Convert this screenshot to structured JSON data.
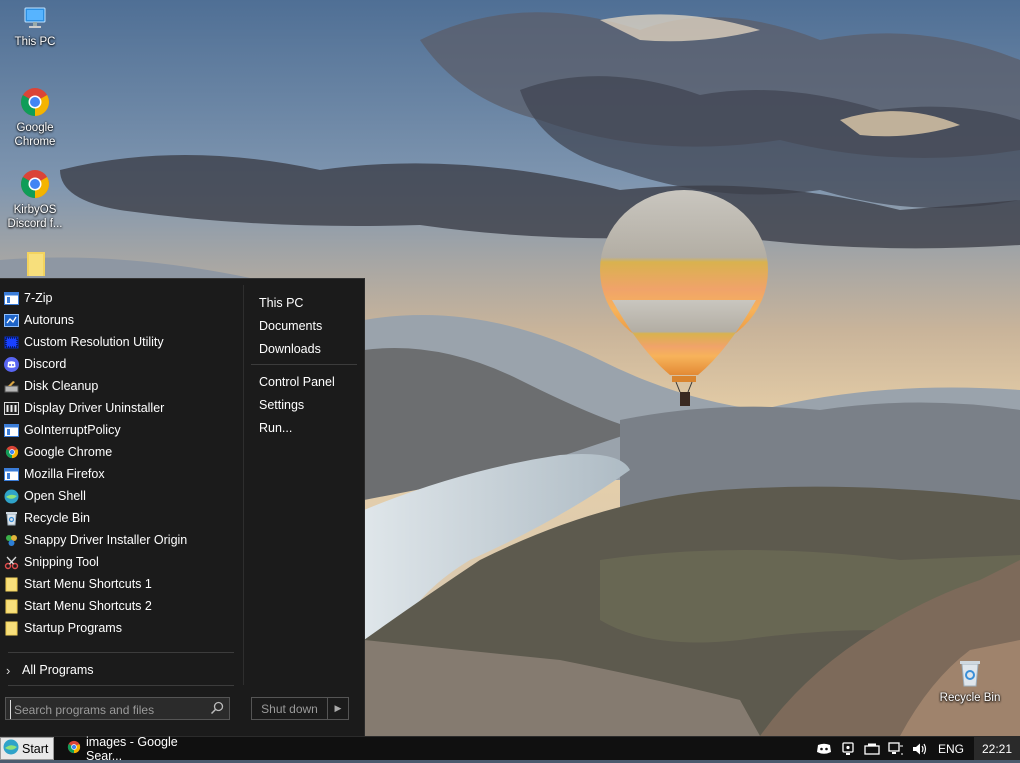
{
  "desktop": {
    "icons": [
      {
        "label": "This PC",
        "icon": "computer-icon"
      },
      {
        "label": "Google Chrome",
        "icon": "chrome-icon"
      },
      {
        "label": "KirbyOS Discord f...",
        "icon": "chrome-icon"
      },
      {
        "label": "",
        "icon": "folder-shortcut-icon"
      },
      {
        "label": "Recycle Bin",
        "icon": "recycle-bin-icon"
      }
    ]
  },
  "start_menu": {
    "programs": [
      {
        "label": "7-Zip",
        "icon": "window-icon"
      },
      {
        "label": "Autoruns",
        "icon": "autoruns-icon"
      },
      {
        "label": "Custom Resolution Utility",
        "icon": "monitor-icon"
      },
      {
        "label": "Discord",
        "icon": "discord-icon"
      },
      {
        "label": "Disk Cleanup",
        "icon": "disk-cleanup-icon"
      },
      {
        "label": "Display Driver Uninstaller",
        "icon": "ddu-icon"
      },
      {
        "label": "GoInterruptPolicy",
        "icon": "window-icon"
      },
      {
        "label": "Google Chrome",
        "icon": "chrome-icon"
      },
      {
        "label": "Mozilla Firefox",
        "icon": "window-icon"
      },
      {
        "label": "Open Shell",
        "icon": "shell-icon"
      },
      {
        "label": "Recycle Bin",
        "icon": "recycle-bin-icon"
      },
      {
        "label": "Snappy Driver Installer Origin",
        "icon": "sdi-icon"
      },
      {
        "label": "Snipping Tool",
        "icon": "scissors-icon"
      },
      {
        "label": "Start Menu Shortcuts 1",
        "icon": "folder-icon"
      },
      {
        "label": "Start Menu Shortcuts 2",
        "icon": "folder-icon"
      },
      {
        "label": "Startup Programs",
        "icon": "folder-icon"
      }
    ],
    "all_programs_label": "All Programs",
    "search_placeholder": "Search programs and files",
    "places_top": [
      "This PC",
      "Documents",
      "Downloads"
    ],
    "places_bottom": [
      "Control Panel",
      "Settings",
      "Run..."
    ],
    "shutdown_label": "Shut down"
  },
  "taskbar": {
    "start_label": "Start",
    "task_label": "images - Google Sear...",
    "tray_icons": [
      "discord-icon",
      "webcam-icon",
      "usb-icon",
      "network-icon",
      "volume-icon"
    ],
    "language": "ENG",
    "clock": "22:21"
  },
  "colors": {
    "menu_bg": "#1b1b1b",
    "taskbar_bg": "#101010",
    "accent_folder": "#f3d35e"
  }
}
